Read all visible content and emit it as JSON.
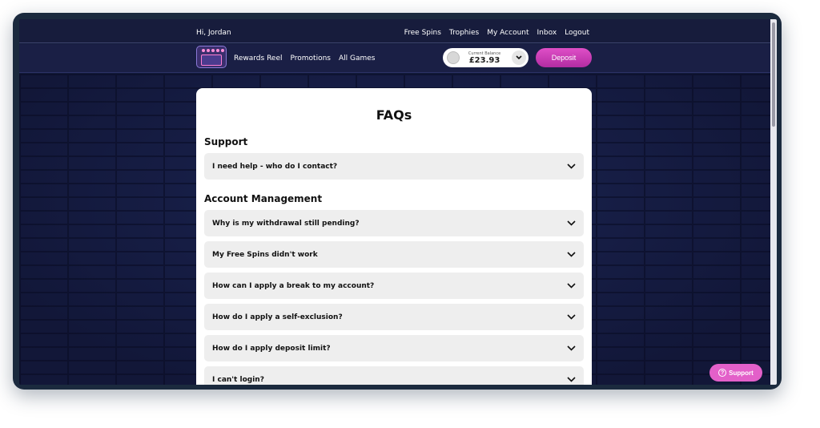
{
  "topbar": {
    "greeting": "Hi, Jordan",
    "links": [
      "Free Spins",
      "Trophies",
      "My Account",
      "Inbox",
      "Logout"
    ]
  },
  "navbar": {
    "logo_icon": "slot-logo-icon",
    "links": [
      "Rewards Reel",
      "Promotions",
      "All Games"
    ],
    "balance_label": "Current Balance",
    "balance_value": "£23.93",
    "deposit_label": "Deposit"
  },
  "faq": {
    "title": "FAQs",
    "sections": [
      {
        "title": "Support",
        "questions": [
          "I need help - who do I contact?"
        ]
      },
      {
        "title": "Account Management",
        "questions": [
          "Why is my withdrawal still pending?",
          "My Free Spins didn't work",
          "How can I apply a break to my account?",
          "How do I apply a self-exclusion?",
          "How do I apply deposit limit?",
          "I can't login?"
        ]
      }
    ]
  },
  "support_button": {
    "label": "Support",
    "icon": "question-circle-icon"
  },
  "colors": {
    "accent": "#e360c9",
    "nav_bg": "#1a1f45",
    "card_bg": "#ffffff"
  }
}
